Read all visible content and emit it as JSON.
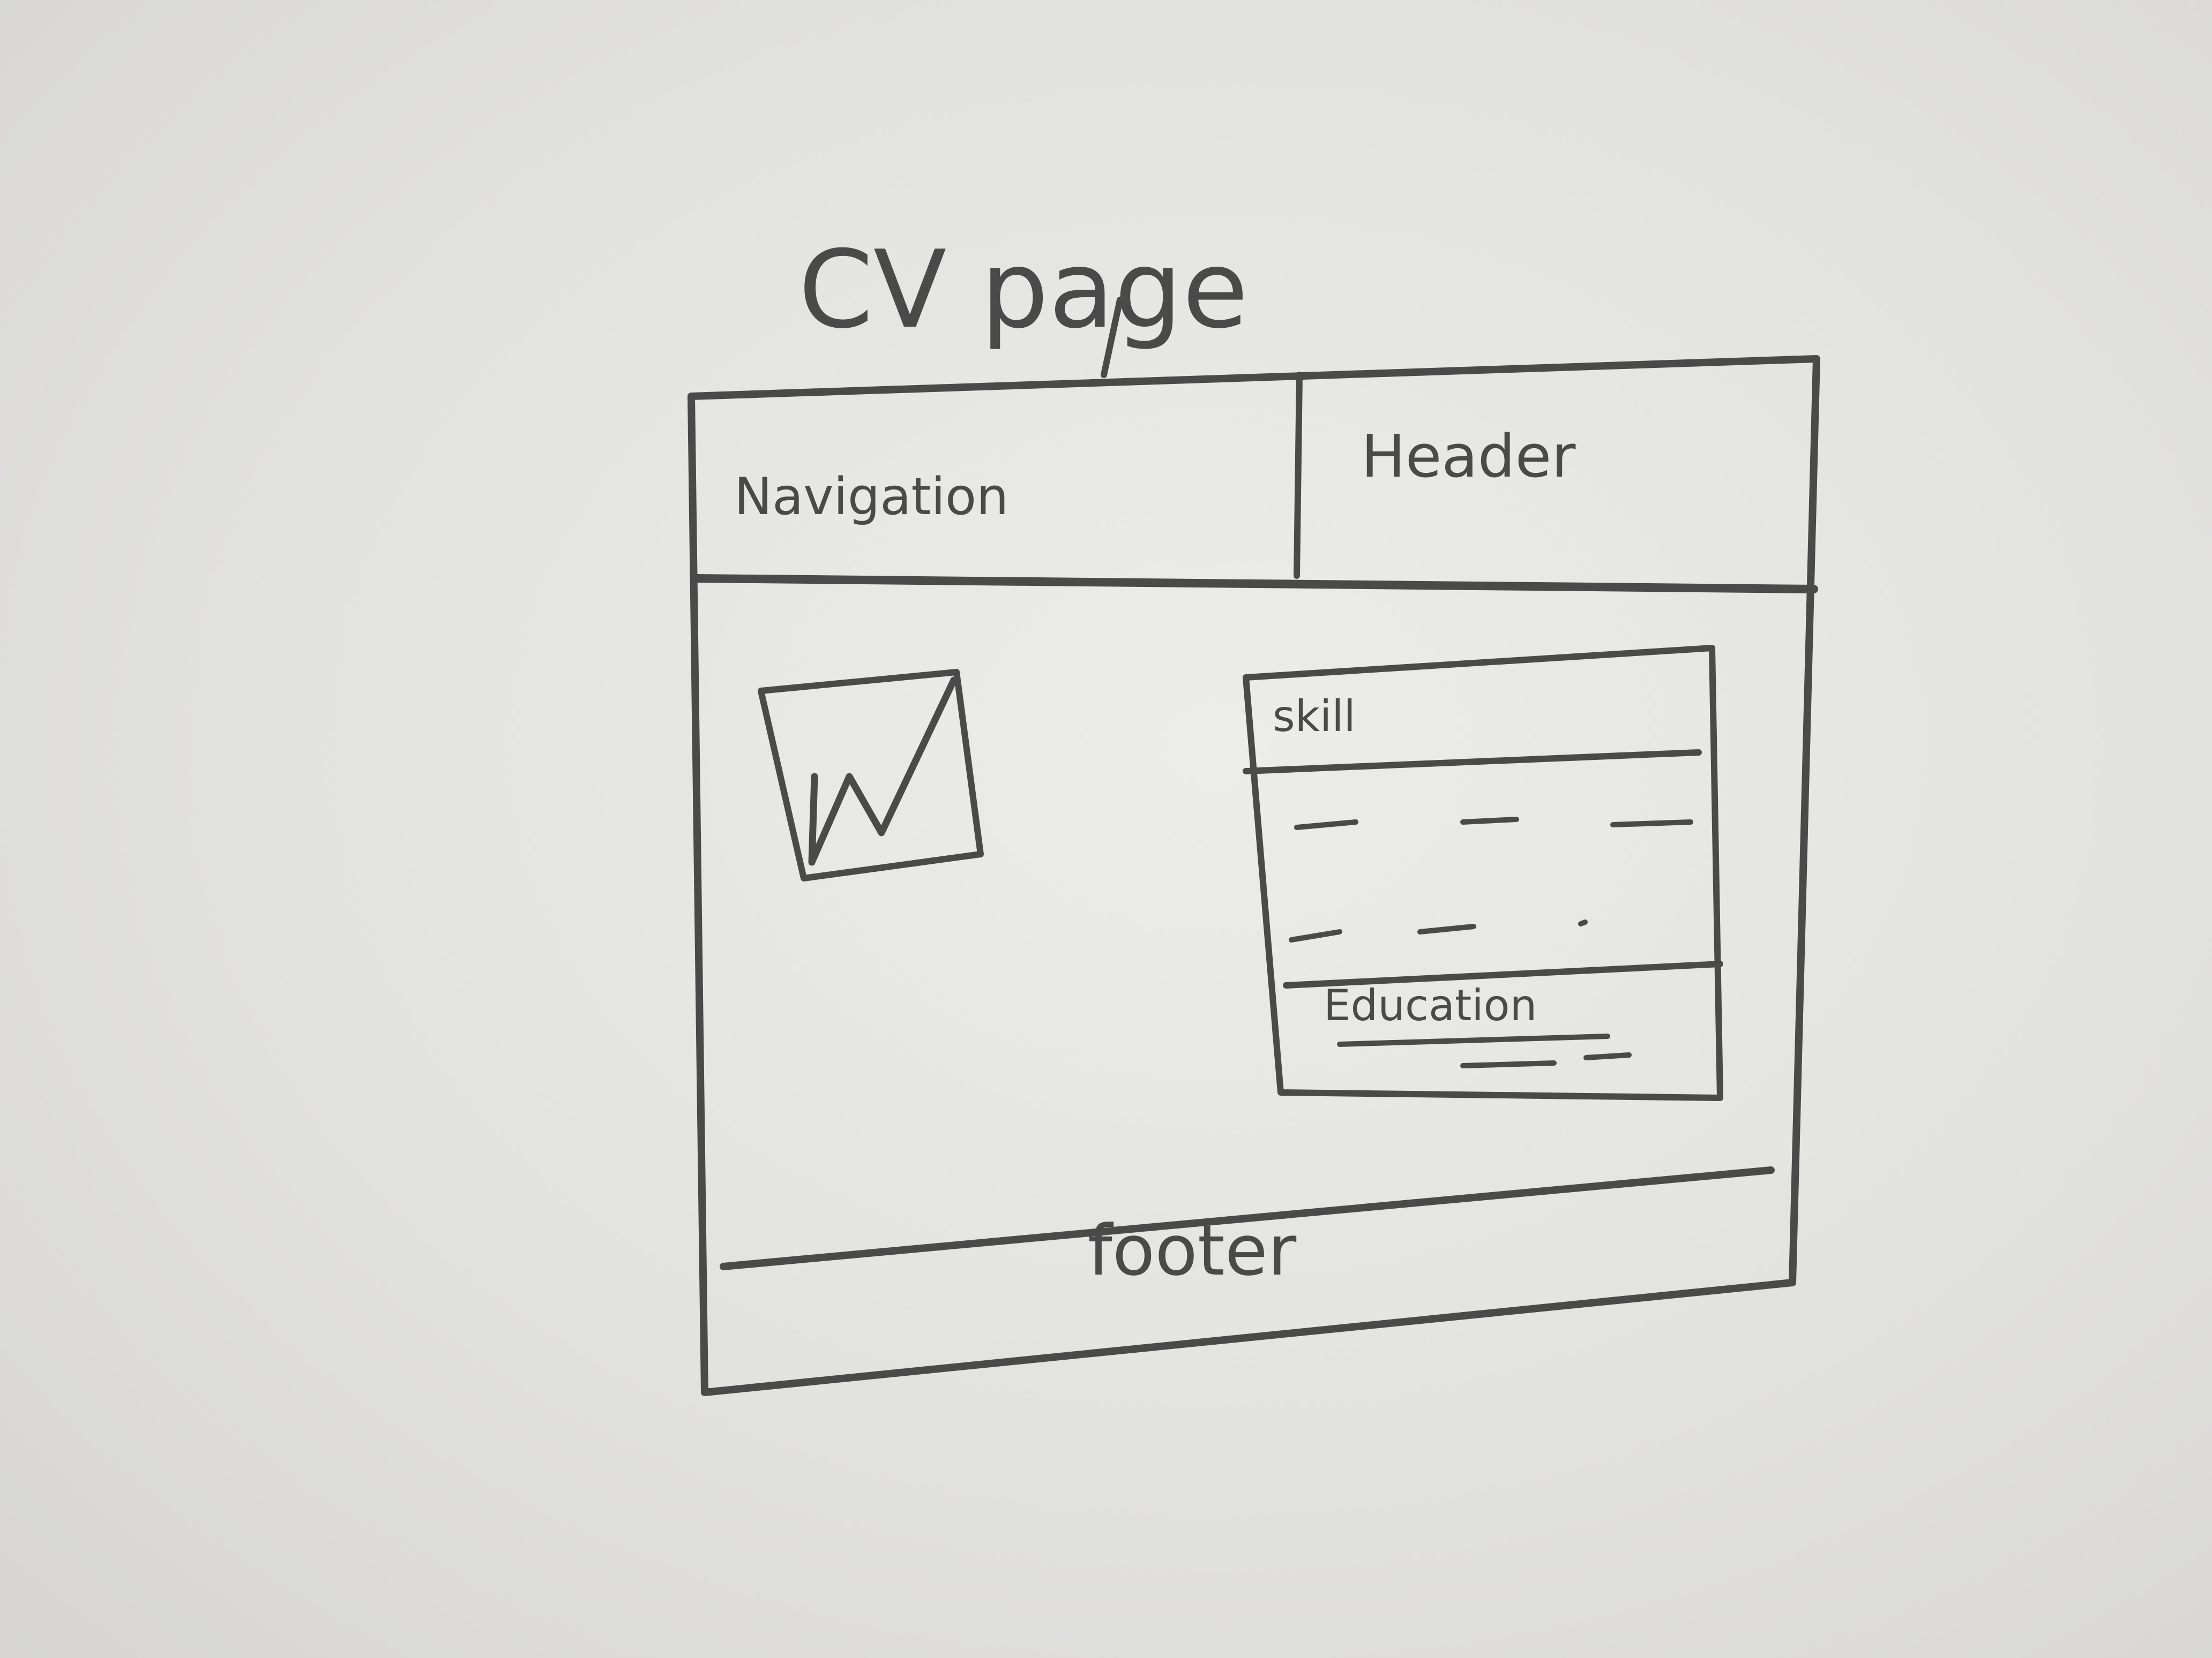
{
  "title": "CV page",
  "header_label": "Header",
  "navigation_label": "Navigation",
  "skill_label": "skill",
  "education_label": "Education",
  "footer_label": "footer",
  "icons": {
    "image_placeholder": "chart-image-icon"
  },
  "colors": {
    "paper": "#e4e4e2",
    "pencil": "#4a4a4a"
  }
}
